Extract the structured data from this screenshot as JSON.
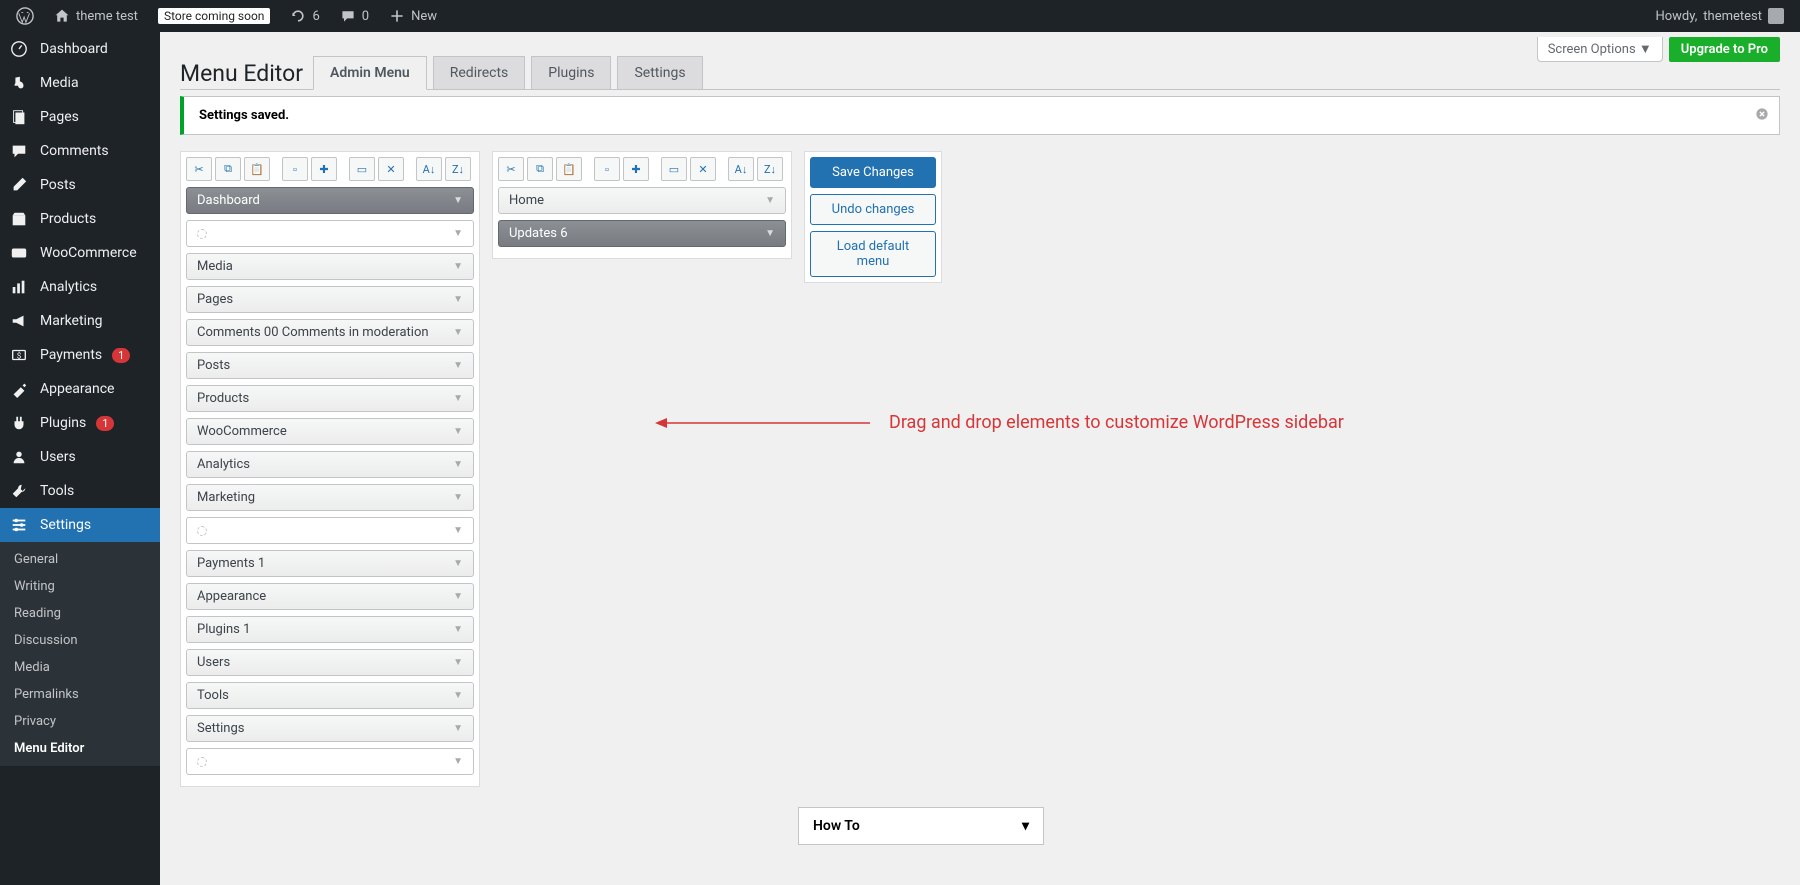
{
  "adminbar": {
    "site_name": "theme test",
    "store_status": "Store coming soon",
    "updates_count": "6",
    "comments_count": "0",
    "new_label": "New",
    "howdy_prefix": "Howdy, ",
    "user_name": "themetest"
  },
  "sidebar": {
    "items": [
      {
        "icon": "dashboard",
        "label": "Dashboard"
      },
      {
        "icon": "media",
        "label": "Media"
      },
      {
        "icon": "pages",
        "label": "Pages"
      },
      {
        "icon": "comments",
        "label": "Comments"
      },
      {
        "icon": "posts",
        "label": "Posts"
      },
      {
        "icon": "products",
        "label": "Products"
      },
      {
        "icon": "woocommerce",
        "label": "WooCommerce"
      },
      {
        "icon": "analytics",
        "label": "Analytics"
      },
      {
        "icon": "marketing",
        "label": "Marketing"
      },
      {
        "icon": "payments",
        "label": "Payments",
        "badge": "1"
      },
      {
        "icon": "appearance",
        "label": "Appearance"
      },
      {
        "icon": "plugins",
        "label": "Plugins",
        "badge": "1"
      },
      {
        "icon": "users",
        "label": "Users"
      },
      {
        "icon": "tools",
        "label": "Tools"
      },
      {
        "icon": "settings",
        "label": "Settings",
        "active": true
      }
    ],
    "sub_items": [
      "General",
      "Writing",
      "Reading",
      "Discussion",
      "Media",
      "Permalinks",
      "Privacy",
      "Menu Editor"
    ]
  },
  "topright": {
    "screen_options": "Screen Options",
    "upgrade": "Upgrade to Pro"
  },
  "header": {
    "title": "Menu Editor",
    "tabs": [
      "Admin Menu",
      "Redirects",
      "Plugins",
      "Settings"
    ]
  },
  "notice": {
    "text": "Settings saved."
  },
  "toolbar_icons": [
    "cut",
    "copy",
    "paste",
    "new",
    "add",
    "hide",
    "del",
    "sortaz",
    "sortza"
  ],
  "left_items": [
    {
      "label": "Dashboard",
      "sel": true
    },
    {
      "sep": true
    },
    {
      "label": "Media"
    },
    {
      "label": "Pages"
    },
    {
      "label": "Comments 00 Comments in moderation"
    },
    {
      "label": "Posts"
    },
    {
      "label": "Products"
    },
    {
      "label": "WooCommerce"
    },
    {
      "label": "Analytics"
    },
    {
      "label": "Marketing"
    },
    {
      "sep": true
    },
    {
      "label": "Payments 1"
    },
    {
      "label": "Appearance"
    },
    {
      "label": "Plugins 1"
    },
    {
      "label": "Users"
    },
    {
      "label": "Tools"
    },
    {
      "label": "Settings"
    },
    {
      "sep": true
    }
  ],
  "mid_items": [
    {
      "label": "Home"
    },
    {
      "label": "Updates 6",
      "sel": true
    }
  ],
  "actions": {
    "save": "Save Changes",
    "undo": "Undo changes",
    "load": "Load default menu"
  },
  "howto": "How To",
  "annotation": "Drag and drop elements to customize WordPress sidebar"
}
